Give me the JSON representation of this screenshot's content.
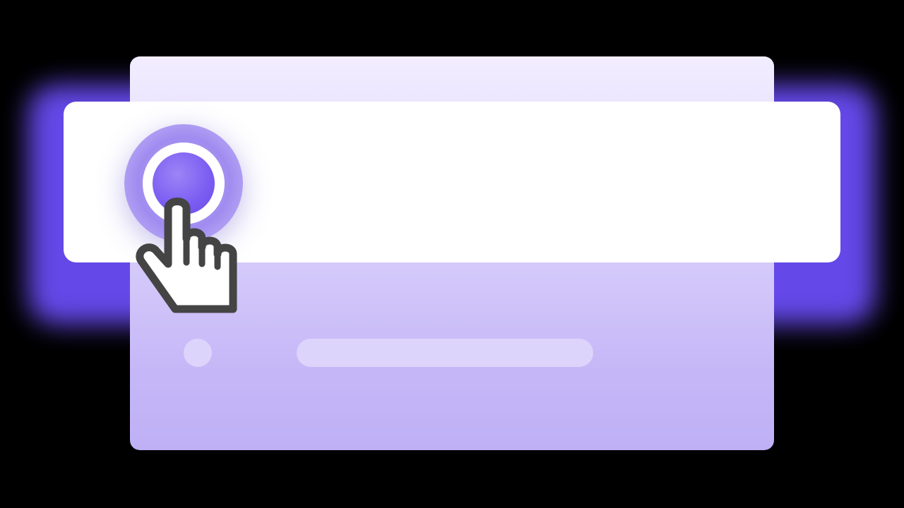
{
  "scene": {
    "accent_color": "#6a4cf5",
    "radio_color": "#7b5cf2",
    "back_card_color": "#c5b7f7",
    "placeholder_color": "#ddd4fb"
  },
  "front_option": {
    "selected": true,
    "icon": "radio-selected-icon"
  },
  "pointer": {
    "icon": "hand-pointer-icon"
  }
}
